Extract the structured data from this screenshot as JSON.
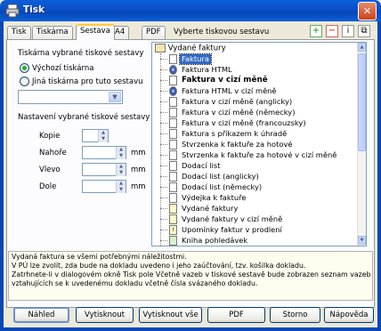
{
  "window": {
    "title": "Tisk"
  },
  "tabs": [
    "Tisk",
    "Tiskárna",
    "Sestava",
    "A4",
    "PDF"
  ],
  "active_tab": "Sestava",
  "hint": "Vyberte tiskovou sestavu",
  "printer_section": {
    "heading": "Tiskárna vybrané tiskové sestavy",
    "option_default": "Výchozí tiskárna",
    "option_other": "Jiná tiskárna pro tuto sestavu",
    "selected": "Výchozí tiskárna",
    "combo_value": ""
  },
  "settings_section": {
    "heading": "Nastavení vybrané tiskové sestavy",
    "copies_label": "Kopie",
    "top_label": "Nahoře",
    "left_label": "Vlevo",
    "bottom_label": "Dole",
    "unit": "mm"
  },
  "tree": {
    "root": "Vydané faktury",
    "items": [
      "Faktura",
      "Faktura HTML",
      "Faktura v cizí měně",
      "Faktura HTML v cizí měně",
      "Faktura v cizí měně (anglicky)",
      "Faktura v cizí měně (německy)",
      "Faktura v cizí měně (francouzsky)",
      "Faktura s příkazem k úhradě",
      "Stvrzenka k faktuře za hotové",
      "Stvrzenka k faktuře za hotové v cizí měně",
      "Dodací list",
      "Dodací list (anglicky)",
      "Dodací list (německy)",
      "Výdejka k faktuře",
      "Vydané faktury",
      "Vydané faktury v cizí měně",
      "Upomínky faktur v prodlení",
      "Kniha pohledávek"
    ],
    "selected": "Faktura"
  },
  "description": [
    "Vydaná faktura se všemi potřebnými náležitostmi.",
    "V PÚ lze zvolit, zda bude na dokladu uvedeno i jeho zaúčtování, tzv. košilka dokladu.",
    "Zatrhnete-li v dialogovém okně Tisk pole Včetně vazeb v tiskové sestavě bude zobrazen seznam vazeb",
    "vztahujících se k uvedenému dokladu včetně čísla svázaného dokladu."
  ],
  "buttons": {
    "preview": "Náhled",
    "print": "Vytisknout",
    "print_all": "Vytisknout vše",
    "pdf": "PDF",
    "cancel": "Storno",
    "help": "Nápověda"
  }
}
